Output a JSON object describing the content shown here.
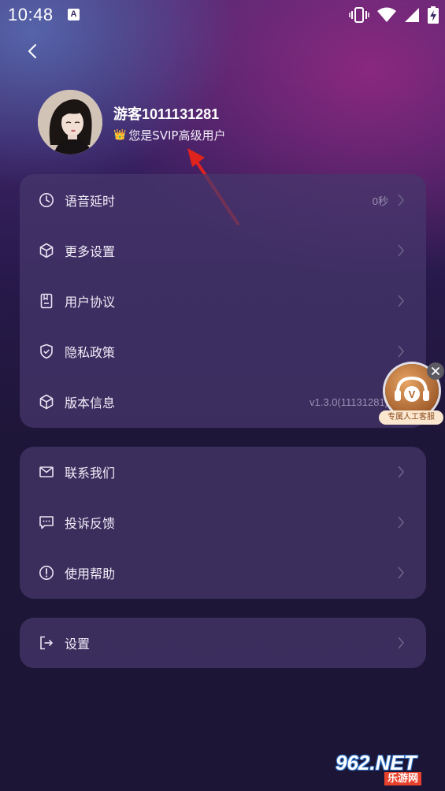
{
  "status_bar": {
    "time": "10:48",
    "notification_icon": "a-notification-icon",
    "icons": [
      "vibrate-icon",
      "wifi-icon",
      "signal-icon",
      "battery-charging-icon"
    ]
  },
  "profile": {
    "username": "游客1011131281",
    "vip_text": "您是SVIP高级用户",
    "crown_icon": "👑"
  },
  "menu_group_1": [
    {
      "label": "语音延时",
      "value": "0秒",
      "icon": "clock-icon"
    },
    {
      "label": "更多设置",
      "value": "",
      "icon": "cube-icon"
    },
    {
      "label": "用户协议",
      "value": "",
      "icon": "document-icon"
    },
    {
      "label": "隐私政策",
      "value": "",
      "icon": "shield-icon"
    },
    {
      "label": "版本信息",
      "value": "v1.3.0(11131281)",
      "icon": "cube-icon"
    }
  ],
  "menu_group_2": [
    {
      "label": "联系我们",
      "value": "",
      "icon": "mail-icon"
    },
    {
      "label": "投诉反馈",
      "value": "",
      "icon": "message-icon"
    },
    {
      "label": "使用帮助",
      "value": "",
      "icon": "alert-icon"
    }
  ],
  "menu_group_3": [
    {
      "label": "设置",
      "value": "",
      "icon": "logout-icon"
    }
  ],
  "floating_service": {
    "label": "专属人工客服",
    "badge_letter": "V"
  },
  "watermark": {
    "top": "962.NET",
    "bottom": "乐游网"
  },
  "colors": {
    "annotation_arrow": "#e0231d",
    "card_bg": "#463868",
    "accent_crown": "#f5c13a"
  }
}
